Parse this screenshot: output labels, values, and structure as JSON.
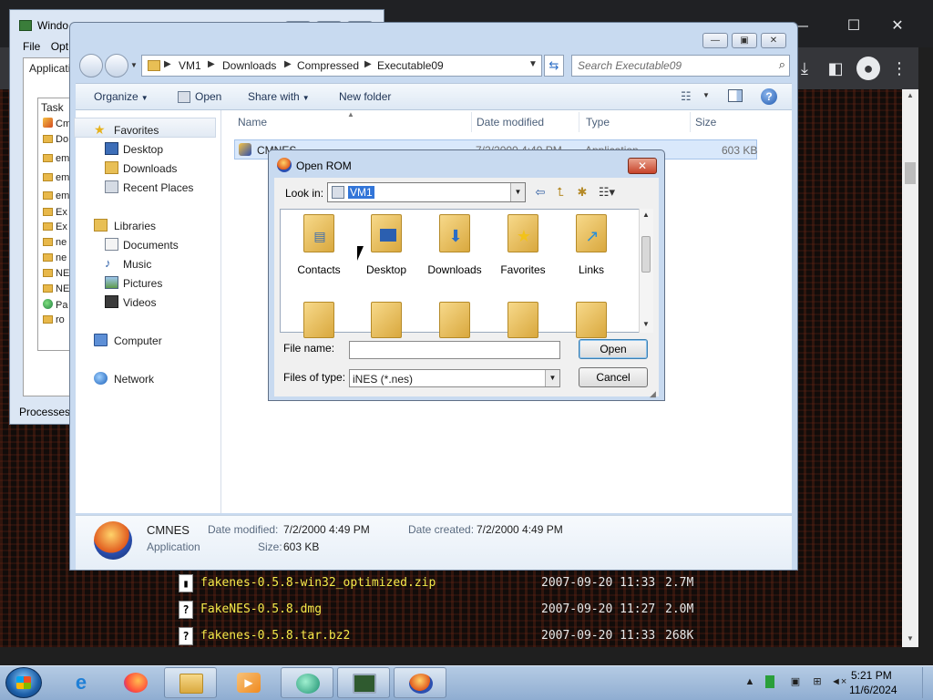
{
  "taskmgr": {
    "title": "Windo",
    "menu": [
      "File",
      "Opt"
    ],
    "tab": "Applicatio",
    "column": "Task",
    "items": [
      "Cm",
      "Do",
      "em",
      "em",
      "em",
      "Ex",
      "Ex",
      "ne",
      "ne",
      "NE",
      "NE",
      "Pa",
      "ro"
    ],
    "processes_label": "Processes:"
  },
  "explorer": {
    "breadcrumb": [
      "VM1",
      "Downloads",
      "Compressed",
      "Executable09"
    ],
    "search_placeholder": "Search Executable09",
    "commands": {
      "organize": "Organize",
      "open": "Open",
      "share_with": "Share with",
      "new_folder": "New folder"
    },
    "nav": {
      "favorites": "Favorites",
      "desktop": "Desktop",
      "downloads": "Downloads",
      "recent_places": "Recent Places",
      "libraries": "Libraries",
      "documents": "Documents",
      "music": "Music",
      "pictures": "Pictures",
      "videos": "Videos",
      "computer": "Computer",
      "network": "Network"
    },
    "columns": {
      "name": "Name",
      "date_modified": "Date modified",
      "type": "Type",
      "size": "Size"
    },
    "row": {
      "name": "CMNES",
      "date": "7/2/2000 4:49 PM",
      "type": "Application",
      "size": "603 KB"
    },
    "details": {
      "name": "CMNES",
      "kind": "Application",
      "date_modified_label": "Date modified:",
      "date_modified": "7/2/2000 4:49 PM",
      "date_created_label": "Date created:",
      "date_created": "7/2/2000 4:49 PM",
      "size_label": "Size:",
      "size": "603 KB"
    }
  },
  "dialog": {
    "title": "Open ROM",
    "look_in_label": "Look in:",
    "look_in_value": "VM1",
    "items": [
      "Contacts",
      "Desktop",
      "Downloads",
      "Favorites",
      "Links"
    ],
    "file_name_label": "File name:",
    "file_name_value": "",
    "files_of_type_label": "Files of type:",
    "files_of_type_value": "iNES (*.nes)",
    "open_button": "Open",
    "cancel_button": "Cancel"
  },
  "browser_listing": [
    {
      "name": "fakenes-0.5.8-win32_optimized.zip",
      "date": "2007-09-20 11:33",
      "size": "2.7M"
    },
    {
      "name": "FakeNES-0.5.8.dmg",
      "date": "2007-09-20 11:27",
      "size": "2.0M"
    },
    {
      "name": "fakenes-0.5.8.tar.bz2",
      "date": "2007-09-20 11:33",
      "size": "268K"
    }
  ],
  "clock": {
    "time": "5:21 PM",
    "date": "11/6/2024"
  }
}
